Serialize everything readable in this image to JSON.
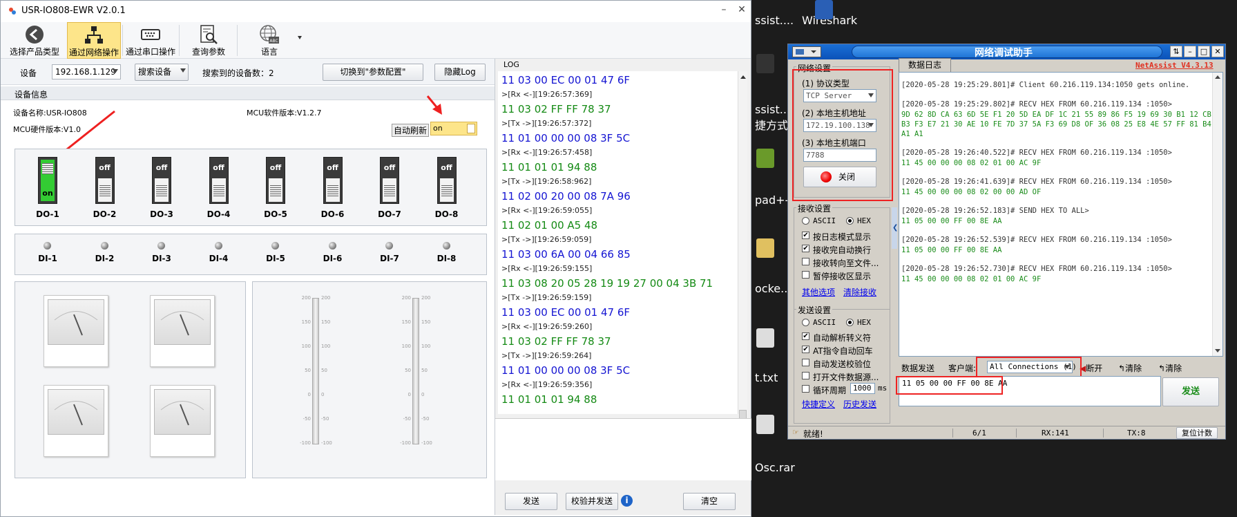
{
  "left_window": {
    "title": "USR-IO808-EWR V2.0.1",
    "toolbar": [
      {
        "label": "选择产品类型",
        "icon": "back-arrow-icon"
      },
      {
        "label": "通过网络操作",
        "icon": "network-icon",
        "active": true
      },
      {
        "label": "通过串口操作",
        "icon": "serial-port-icon"
      },
      {
        "label": "查询参数",
        "icon": "search-document-icon"
      },
      {
        "label": "语言",
        "icon": "globe-language-icon"
      }
    ],
    "device_bar": {
      "device_label": "设备",
      "ip_value": "192.168.1.129",
      "search_button": "搜索设备",
      "found_label": "搜索到的设备数：2",
      "switch_button": "切换到\"参数配置\"",
      "hide_log_button": "隐藏Log"
    },
    "device_info": {
      "section_title": "设备信息",
      "name": "设备名称:USR-IO808",
      "mcu_sw": "MCU软件版本:V1.2.7",
      "mcu_hw": "MCU硬件版本:V1.0",
      "auto_refresh_label": "自动刷新",
      "auto_refresh_value": "on"
    },
    "do_switches": [
      {
        "label": "DO-1",
        "state": "on"
      },
      {
        "label": "DO-2",
        "state": "off"
      },
      {
        "label": "DO-3",
        "state": "off"
      },
      {
        "label": "DO-4",
        "state": "off"
      },
      {
        "label": "DO-5",
        "state": "off"
      },
      {
        "label": "DO-6",
        "state": "off"
      },
      {
        "label": "DO-7",
        "state": "off"
      },
      {
        "label": "DO-8",
        "state": "off"
      }
    ],
    "di_inputs": [
      "DI-1",
      "DI-2",
      "DI-3",
      "DI-4",
      "DI-5",
      "DI-6",
      "DI-7",
      "DI-8"
    ],
    "slider_ticks": [
      "200",
      "150",
      "100",
      "50",
      "0",
      "-50",
      "-100"
    ],
    "log": {
      "title": "LOG",
      "lines": [
        {
          "text": "11 03 00 EC 00 01 47 6F",
          "kind": "rx"
        },
        {
          "text": ">[Rx <-][19:26:57:369]",
          "kind": "meta"
        },
        {
          "text": "11 03 02 FF FF 78 37",
          "kind": "tx"
        },
        {
          "text": ">[Tx ->][19:26:57:372]",
          "kind": "meta"
        },
        {
          "text": "11 01 00 00 00 08 3F 5C",
          "kind": "rx"
        },
        {
          "text": ">[Rx <-][19:26:57:458]",
          "kind": "meta"
        },
        {
          "text": "11 01 01 01 94 88",
          "kind": "tx"
        },
        {
          "text": ">[Tx ->][19:26:58:962]",
          "kind": "meta"
        },
        {
          "text": "11 02 00 20 00 08 7A 96",
          "kind": "rx"
        },
        {
          "text": ">[Rx <-][19:26:59:055]",
          "kind": "meta"
        },
        {
          "text": "11 02 01 00 A5 48",
          "kind": "tx"
        },
        {
          "text": ">[Tx ->][19:26:59:059]",
          "kind": "meta"
        },
        {
          "text": "11 03 00 6A 00 04 66 85",
          "kind": "rx"
        },
        {
          "text": ">[Rx <-][19:26:59:155]",
          "kind": "meta"
        },
        {
          "text": "11 03 08 20 05 28 19 19 27 00 04 3B 71",
          "kind": "tx"
        },
        {
          "text": ">[Tx ->][19:26:59:159]",
          "kind": "meta"
        },
        {
          "text": "11 03 00 EC 00 01 47 6F",
          "kind": "rx"
        },
        {
          "text": ">[Rx <-][19:26:59:260]",
          "kind": "meta"
        },
        {
          "text": "11 03 02 FF FF 78 37",
          "kind": "tx"
        },
        {
          "text": ">[Tx ->][19:26:59:264]",
          "kind": "meta"
        },
        {
          "text": "11 01 00 00 00 08 3F 5C",
          "kind": "rx"
        },
        {
          "text": ">[Rx <-][19:26:59:356]",
          "kind": "meta"
        },
        {
          "text": "11 01 01 01 94 88",
          "kind": "tx"
        }
      ],
      "send_button": "发送",
      "verify_send_button": "校验并发送",
      "clear_button": "清空"
    },
    "colors": {
      "rx": "#1414d2",
      "tx": "#148a14",
      "active_tab": "#fde58a",
      "on_switch": "#33cc33"
    }
  },
  "desktop": {
    "icons": [
      {
        "label": "Wireshark"
      },
      {
        "label": "ssist...."
      },
      {
        "label": "ssist..."
      },
      {
        "label": "捷方式"
      },
      {
        "label": "pad+-"
      },
      {
        "label": "ocke..."
      },
      {
        "label": "t.txt"
      },
      {
        "label": "Osc.rar"
      }
    ]
  },
  "netassist": {
    "title": "网络调试助手",
    "brand": "NetAssist V4.3.13",
    "net_settings": {
      "title": "网络设置",
      "protocol_label": "(1) 协议类型",
      "protocol_value": "TCP Server",
      "host_label": "(2) 本地主机地址",
      "host_value": "172.19.100.138",
      "port_label": "(3) 本地主机端口",
      "port_value": "7788",
      "close_button": "关闭"
    },
    "recv_settings": {
      "title": "接收设置",
      "ascii": "ASCII",
      "hex": "HEX",
      "options": [
        {
          "label": "按日志模式显示",
          "checked": true
        },
        {
          "label": "接收完自动换行",
          "checked": true
        },
        {
          "label": "接收转向至文件...",
          "checked": false
        },
        {
          "label": "暂停接收区显示",
          "checked": false
        }
      ],
      "link1": "其他选项",
      "link2": "清除接收"
    },
    "send_settings": {
      "title": "发送设置",
      "ascii": "ASCII",
      "hex": "HEX",
      "options": [
        {
          "label": "自动解析转义符",
          "checked": true
        },
        {
          "label": "AT指令自动回车",
          "checked": true
        },
        {
          "label": "自动发送校验位",
          "checked": false
        },
        {
          "label": "打开文件数据源...",
          "checked": false
        },
        {
          "label": "循环周期",
          "checked": false
        }
      ],
      "period_value": "1000",
      "period_unit": "ms",
      "link1": "快捷定义",
      "link2": "历史发送"
    },
    "log_tab": "数据日志",
    "log_entries": [
      {
        "head": "[2020-05-28 19:25:29.801]# Client 60.216.119.134:1050 gets online.",
        "data": []
      },
      {
        "head": "[2020-05-28 19:25:29.802]# RECV HEX FROM 60.216.119.134 :1050>",
        "data": [
          "9D 62 8D CA 63 6D 5E F1 20 5D EA DF 1C 21 55 89 86 F5 19 69 30 B1 12 CB",
          "B3 F3 E7 21 30 AE 10 FE 7D 37 5A F3 69 D8 OF 36 08 25 E8 4E 57 FF 81 B4",
          "A1 A1"
        ]
      },
      {
        "head": "[2020-05-28 19:26:40.522]# RECV HEX FROM 60.216.119.134 :1050>",
        "data": [
          "11 45 00 00 00 08 02 01 00 AC 9F"
        ]
      },
      {
        "head": "[2020-05-28 19:26:41.639]# RECV HEX FROM 60.216.119.134 :1050>",
        "data": [
          "11 45 00 00 00 08 02 00 00 AD OF"
        ]
      },
      {
        "head": "[2020-05-28 19:26:52.183]# SEND HEX TO ALL>",
        "data": [
          "11 05 00 00 FF 00 8E AA"
        ]
      },
      {
        "head": "[2020-05-28 19:26:52.539]# RECV HEX FROM 60.216.119.134 :1050>",
        "data": [
          "11 05 00 00 FF 00 8E AA"
        ]
      },
      {
        "head": "[2020-05-28 19:26:52.730]# RECV HEX FROM 60.216.119.134 :1050>",
        "data": [
          "11 45 00 00 00 08 02 01 00 AC 9F"
        ]
      }
    ],
    "send_bar": {
      "tab": "数据发送",
      "client_label": "客户端:",
      "client_value": "All Connections (1)",
      "disconnect": "断开",
      "clear1": "清除",
      "clear2": "清除"
    },
    "send_text": "11 05 00 00 FF 00 8E AA",
    "send_button": "发送",
    "status": {
      "ready": "就绪!",
      "count": "6/1",
      "rx": "RX:141",
      "tx": "TX:8",
      "reset": "复位计数"
    },
    "colors": {
      "data": "#1a8c1a",
      "brand": "#e03020",
      "title_bar": "#0b52b8"
    }
  }
}
